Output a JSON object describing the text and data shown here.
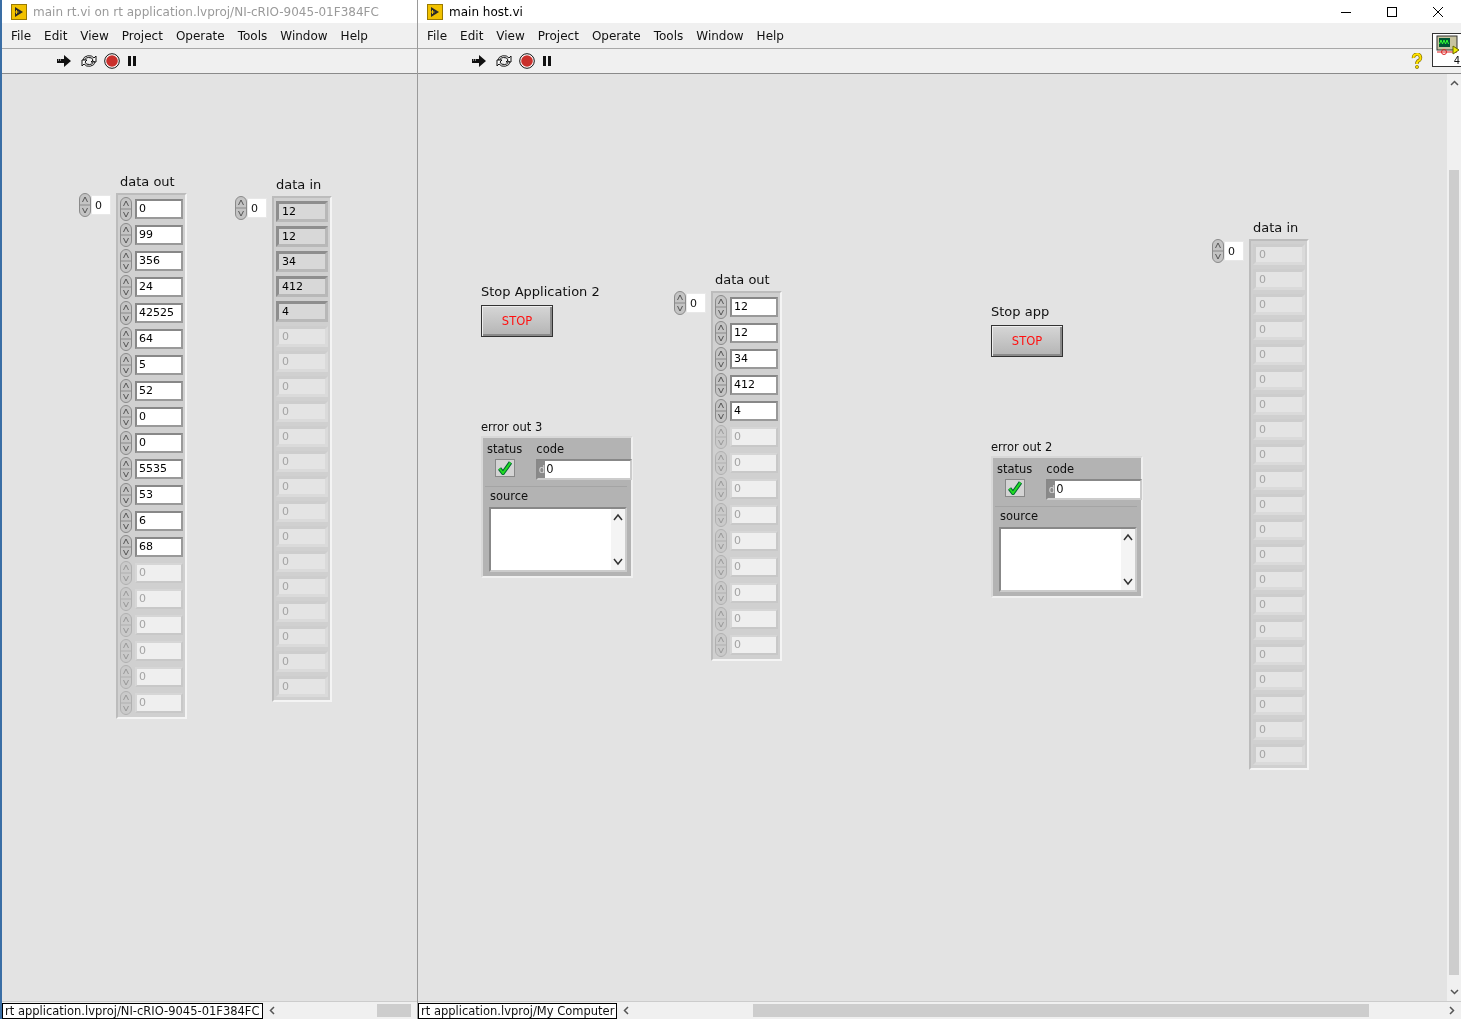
{
  "windows": [
    {
      "title": "main rt.vi on rt application.lvproj/NI-cRIO-9045-01F384FC",
      "active": false,
      "menu": [
        "File",
        "Edit",
        "View",
        "Project",
        "Operate",
        "Tools",
        "Window",
        "Help"
      ],
      "controls": [
        {
          "kind": "control_array",
          "label": "data out",
          "index": "0",
          "elements": [
            {
              "value": "0",
              "in_range": true
            },
            {
              "value": "99",
              "in_range": true
            },
            {
              "value": "356",
              "in_range": true
            },
            {
              "value": "24",
              "in_range": true
            },
            {
              "value": "42525",
              "in_range": true
            },
            {
              "value": "64",
              "in_range": true
            },
            {
              "value": "5",
              "in_range": true
            },
            {
              "value": "52",
              "in_range": true
            },
            {
              "value": "0",
              "in_range": true
            },
            {
              "value": "0",
              "in_range": true
            },
            {
              "value": "5535",
              "in_range": true
            },
            {
              "value": "53",
              "in_range": true
            },
            {
              "value": "6",
              "in_range": true
            },
            {
              "value": "68",
              "in_range": true
            },
            {
              "value": "0",
              "in_range": false
            },
            {
              "value": "0",
              "in_range": false
            },
            {
              "value": "0",
              "in_range": false
            },
            {
              "value": "0",
              "in_range": false
            },
            {
              "value": "0",
              "in_range": false
            },
            {
              "value": "0",
              "in_range": false
            }
          ]
        },
        {
          "kind": "indicator_array",
          "label": "data in",
          "index": "0",
          "elements": [
            {
              "value": "12",
              "in_range": true
            },
            {
              "value": "12",
              "in_range": true
            },
            {
              "value": "34",
              "in_range": true
            },
            {
              "value": "412",
              "in_range": true
            },
            {
              "value": "4",
              "in_range": true
            },
            {
              "value": "0",
              "in_range": false
            },
            {
              "value": "0",
              "in_range": false
            },
            {
              "value": "0",
              "in_range": false
            },
            {
              "value": "0",
              "in_range": false
            },
            {
              "value": "0",
              "in_range": false
            },
            {
              "value": "0",
              "in_range": false
            },
            {
              "value": "0",
              "in_range": false
            },
            {
              "value": "0",
              "in_range": false
            },
            {
              "value": "0",
              "in_range": false
            },
            {
              "value": "0",
              "in_range": false
            },
            {
              "value": "0",
              "in_range": false
            },
            {
              "value": "0",
              "in_range": false
            },
            {
              "value": "0",
              "in_range": false
            },
            {
              "value": "0",
              "in_range": false
            },
            {
              "value": "0",
              "in_range": false
            }
          ]
        }
      ],
      "status_path": "rt application.lvproj/NI-cRIO-9045-01F384FC"
    },
    {
      "title": "main host.vi",
      "active": true,
      "menu": [
        "File",
        "Edit",
        "View",
        "Project",
        "Operate",
        "Tools",
        "Window",
        "Help"
      ],
      "icon_badge": "4",
      "controls": [
        {
          "kind": "button",
          "label": "Stop Application 2",
          "text": "STOP"
        },
        {
          "kind": "error_cluster",
          "label": "error out 3",
          "status_label": "status",
          "error": false,
          "code_label": "code",
          "radix": "d",
          "code": "0",
          "source_label": "source"
        },
        {
          "kind": "control_array",
          "label": "data out",
          "index": "0",
          "elements": [
            {
              "value": "12",
              "in_range": true
            },
            {
              "value": "12",
              "in_range": true
            },
            {
              "value": "34",
              "in_range": true
            },
            {
              "value": "412",
              "in_range": true
            },
            {
              "value": "4",
              "in_range": true
            },
            {
              "value": "0",
              "in_range": false
            },
            {
              "value": "0",
              "in_range": false
            },
            {
              "value": "0",
              "in_range": false
            },
            {
              "value": "0",
              "in_range": false
            },
            {
              "value": "0",
              "in_range": false
            },
            {
              "value": "0",
              "in_range": false
            },
            {
              "value": "0",
              "in_range": false
            },
            {
              "value": "0",
              "in_range": false
            },
            {
              "value": "0",
              "in_range": false
            }
          ]
        },
        {
          "kind": "button",
          "label": "Stop app",
          "text": "STOP"
        },
        {
          "kind": "error_cluster",
          "label": "error out 2",
          "status_label": "status",
          "error": false,
          "code_label": "code",
          "radix": "d",
          "code": "0",
          "source_label": "source"
        },
        {
          "kind": "indicator_array",
          "label": "data in",
          "index": "0",
          "elements": [
            {
              "value": "0",
              "in_range": false
            },
            {
              "value": "0",
              "in_range": false
            },
            {
              "value": "0",
              "in_range": false
            },
            {
              "value": "0",
              "in_range": false
            },
            {
              "value": "0",
              "in_range": false
            },
            {
              "value": "0",
              "in_range": false
            },
            {
              "value": "0",
              "in_range": false
            },
            {
              "value": "0",
              "in_range": false
            },
            {
              "value": "0",
              "in_range": false
            },
            {
              "value": "0",
              "in_range": false
            },
            {
              "value": "0",
              "in_range": false
            },
            {
              "value": "0",
              "in_range": false
            },
            {
              "value": "0",
              "in_range": false
            },
            {
              "value": "0",
              "in_range": false
            },
            {
              "value": "0",
              "in_range": false
            },
            {
              "value": "0",
              "in_range": false
            },
            {
              "value": "0",
              "in_range": false
            },
            {
              "value": "0",
              "in_range": false
            },
            {
              "value": "0",
              "in_range": false
            },
            {
              "value": "0",
              "in_range": false
            },
            {
              "value": "0",
              "in_range": false
            }
          ]
        }
      ],
      "status_path": "rt application.lvproj/My Computer"
    }
  ]
}
